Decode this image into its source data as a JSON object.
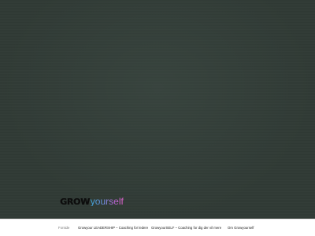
{
  "header": {
    "logo_part1": "GROW",
    "logo_part2": "yourself"
  },
  "nav": {
    "items": [
      {
        "label": "Forside",
        "active": true
      },
      {
        "label": "Growyour LEADERSHIP – Coaching for ledere",
        "active": false
      },
      {
        "label": "GrowyourSELF – Coaching for dig der vil mere",
        "active": false
      },
      {
        "label": "Om Growyourself",
        "active": false
      }
    ]
  },
  "colors": {
    "hero_background": "#303a35",
    "logo_grow": "#0d0d0d",
    "logo_gradient": [
      "#3ea6d8",
      "#b866d8",
      "#e062c8"
    ],
    "nav_text": "#222222",
    "nav_active_text": "#777777"
  }
}
